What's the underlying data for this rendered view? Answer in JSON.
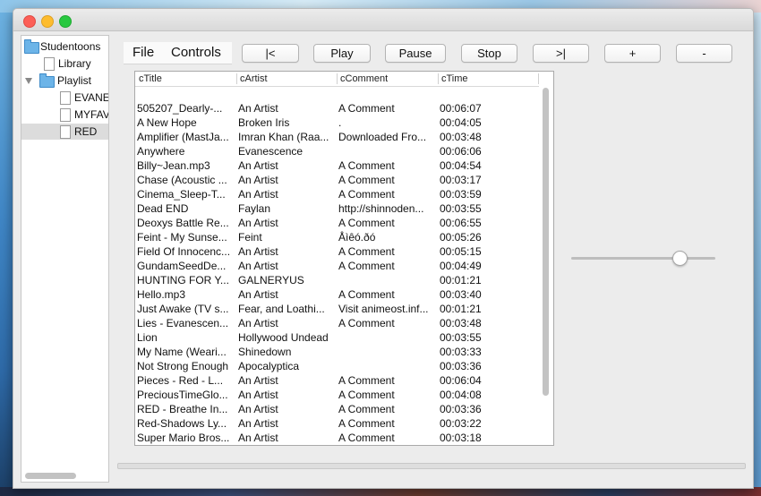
{
  "tree": {
    "items": [
      {
        "label": "Studentoons",
        "icon": "folder-icon"
      },
      {
        "label": "Library",
        "icon": "file-icon"
      },
      {
        "label": "Playlist",
        "icon": "folder-icon",
        "expanded": true
      },
      {
        "label": "EVANE",
        "icon": "file-icon"
      },
      {
        "label": "MYFAV",
        "icon": "file-icon"
      },
      {
        "label": "RED",
        "icon": "file-icon"
      }
    ]
  },
  "menu": {
    "file": "File",
    "controls": "Controls"
  },
  "toolbar": {
    "prev": "|<",
    "play": "Play",
    "pause": "Pause",
    "stop": "Stop",
    "next": ">|",
    "vol_up": "+",
    "vol_down": "-"
  },
  "table": {
    "columns": [
      "cTitle",
      "cArtist",
      "cComment",
      "cTime"
    ],
    "rows": [
      [
        "505207_Dearly-...",
        "An Artist",
        "A Comment",
        "00:06:07"
      ],
      [
        "A New Hope",
        "Broken Iris",
        ".",
        "00:04:05"
      ],
      [
        "Amplifier (MastJa...",
        "Imran Khan (Raa...",
        "Downloaded Fro...",
        "00:03:48"
      ],
      [
        "Anywhere",
        "Evanescence",
        "",
        "00:06:06"
      ],
      [
        "Billy~Jean.mp3",
        "An Artist",
        "A Comment",
        "00:04:54"
      ],
      [
        "Chase (Acoustic ...",
        "An Artist",
        "A Comment",
        "00:03:17"
      ],
      [
        "Cinema_Sleep-T...",
        "An Artist",
        "A Comment",
        "00:03:59"
      ],
      [
        "Dead END",
        "Faylan",
        "http://shinnoden...",
        "00:03:55"
      ],
      [
        "Deoxys Battle Re...",
        "An Artist",
        "A Comment",
        "00:06:55"
      ],
      [
        "Feint - My Sunse...",
        "Feint",
        "Åìêó.ðó",
        "00:05:26"
      ],
      [
        "Field Of Innocenc...",
        "An Artist",
        "A Comment",
        "00:05:15"
      ],
      [
        "GundamSeedDe...",
        "An Artist",
        "A Comment",
        "00:04:49"
      ],
      [
        "HUNTING FOR Y...",
        "GALNERYUS",
        "",
        "00:01:21"
      ],
      [
        "Hello.mp3",
        "An Artist",
        "A Comment",
        "00:03:40"
      ],
      [
        "Just Awake (TV s...",
        "Fear, and Loathi...",
        "Visit animeost.inf...",
        "00:01:21"
      ],
      [
        "Lies - Evanescen...",
        "An Artist",
        "A Comment",
        "00:03:48"
      ],
      [
        "Lion",
        "Hollywood Undead",
        "",
        "00:03:55"
      ],
      [
        "My Name (Weari...",
        "Shinedown",
        "",
        "00:03:33"
      ],
      [
        "Not Strong Enough",
        "Apocalyptica",
        "",
        "00:03:36"
      ],
      [
        "Pieces - Red - L...",
        "An Artist",
        "A Comment",
        "00:06:04"
      ],
      [
        "PreciousTimeGlo...",
        "An Artist",
        "A Comment",
        "00:04:08"
      ],
      [
        "RED - Breathe In...",
        "An Artist",
        "A Comment",
        "00:03:36"
      ],
      [
        "Red-Shadows Ly...",
        "An Artist",
        "A Comment",
        "00:03:22"
      ],
      [
        "Super Mario Bros...",
        "An Artist",
        "A Comment",
        "00:03:18"
      ]
    ]
  },
  "volume": {
    "level": 0.75
  },
  "progress": {
    "level": 0.0
  }
}
